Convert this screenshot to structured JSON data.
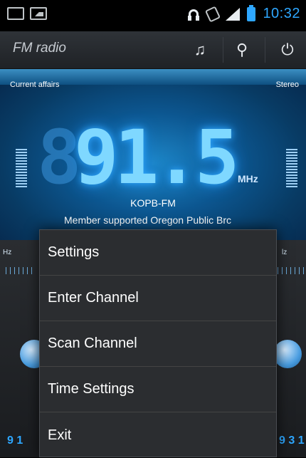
{
  "status_bar": {
    "time": "10:32",
    "icons": [
      "screen-icon",
      "image-icon",
      "headphones-icon",
      "vibrate-icon",
      "signal-icon",
      "battery-icon"
    ]
  },
  "toolbar": {
    "title": "FM radio",
    "icons": [
      "music-note-icon",
      "satellite-icon",
      "power-icon"
    ]
  },
  "radio": {
    "program_label": "Current affairs",
    "audio_mode": "Stereo",
    "frequency": "91.5",
    "frequency_ghost": "8",
    "unit": "MHz",
    "station_name": "KOPB-FM",
    "station_desc": "Member supported Oregon Public Brc"
  },
  "scale": {
    "left_label": "Hz",
    "right_label": "lz"
  },
  "bottom_bar": {
    "left_freq": "9 1",
    "right_freq": "9 3 1"
  },
  "menu": {
    "items": [
      {
        "label": "Settings"
      },
      {
        "label": "Enter Channel"
      },
      {
        "label": "Scan Channel"
      },
      {
        "label": "Time Settings"
      },
      {
        "label": "Exit"
      }
    ]
  },
  "colors": {
    "accent": "#2ea7ff",
    "panel_blue": "#0c5690",
    "menu_bg": "#2b2d30"
  }
}
